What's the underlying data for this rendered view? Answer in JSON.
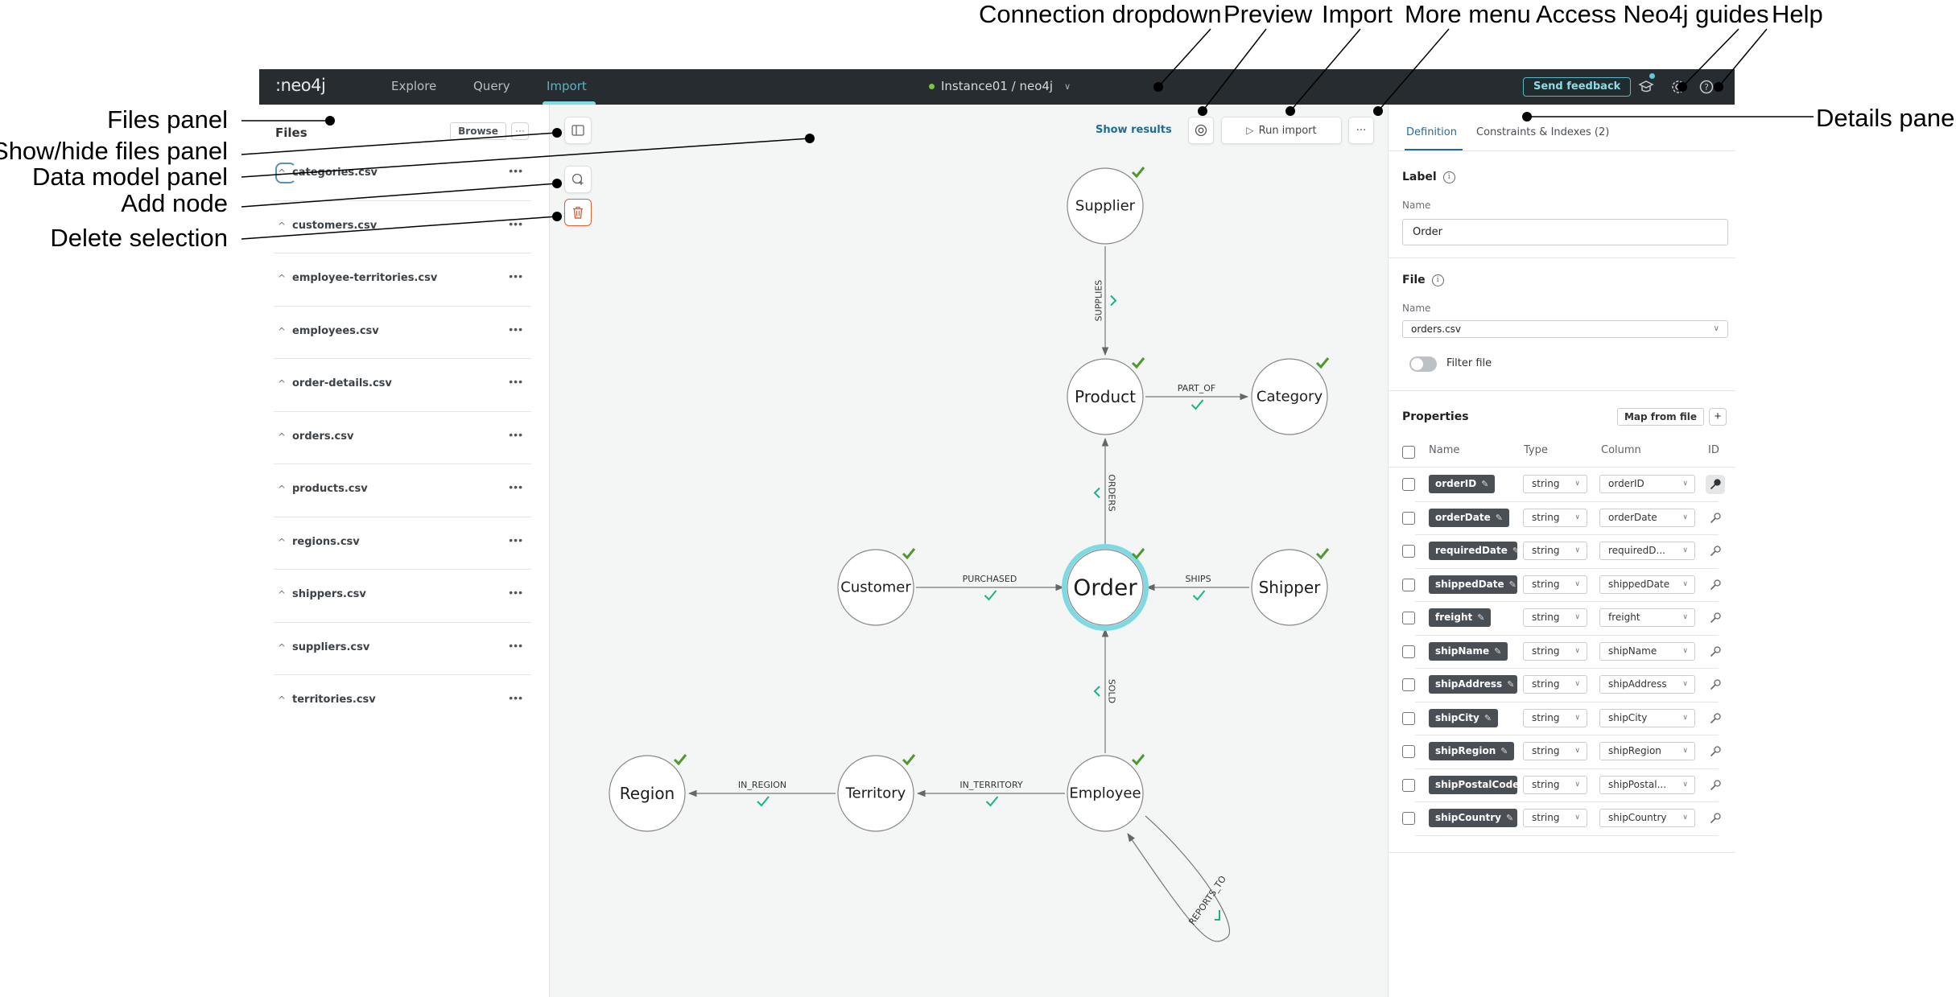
{
  "annotations": {
    "top": [
      "Connection dropdown",
      "Preview",
      "Import",
      "More menu",
      "Access Neo4j guides",
      "Help"
    ],
    "left": [
      "Files panel",
      "Show/hide files panel",
      "Data model panel",
      "Add node",
      "Delete selection"
    ],
    "right": [
      "Details panel"
    ]
  },
  "nav": {
    "logo": ":neo4j",
    "tabs": [
      {
        "label": "Explore",
        "active": false
      },
      {
        "label": "Query",
        "active": false
      },
      {
        "label": "Import",
        "active": true
      }
    ],
    "connection": "Instance01 / neo4j",
    "connection_status_color": "#7cc242",
    "feedback_label": "Send feedback",
    "icons": [
      "graduation-cap-icon",
      "gear-icon",
      "help-icon"
    ]
  },
  "files": {
    "title": "Files",
    "browse_label": "Browse",
    "more_label": "···",
    "items": [
      {
        "name": "categories.csv"
      },
      {
        "name": "customers.csv"
      },
      {
        "name": "employee-territories.csv"
      },
      {
        "name": "employees.csv"
      },
      {
        "name": "order-details.csv"
      },
      {
        "name": "orders.csv"
      },
      {
        "name": "products.csv"
      },
      {
        "name": "regions.csv"
      },
      {
        "name": "shippers.csv"
      },
      {
        "name": "suppliers.csv"
      },
      {
        "name": "territories.csv"
      }
    ]
  },
  "canvas": {
    "show_results_label": "Show results",
    "run_import_label": "Run import",
    "more_label": "···",
    "nodes": [
      {
        "id": "supplier",
        "label": "Supplier",
        "mapped": true,
        "selected": false
      },
      {
        "id": "product",
        "label": "Product",
        "mapped": true,
        "selected": false
      },
      {
        "id": "category",
        "label": "Category",
        "mapped": true,
        "selected": false
      },
      {
        "id": "customer",
        "label": "Customer",
        "mapped": true,
        "selected": false
      },
      {
        "id": "order",
        "label": "Order",
        "mapped": true,
        "selected": true
      },
      {
        "id": "shipper",
        "label": "Shipper",
        "mapped": true,
        "selected": false
      },
      {
        "id": "region",
        "label": "Region",
        "mapped": true,
        "selected": false
      },
      {
        "id": "territory",
        "label": "Territory",
        "mapped": true,
        "selected": false
      },
      {
        "id": "employee",
        "label": "Employee",
        "mapped": true,
        "selected": false
      }
    ],
    "relationships": [
      {
        "type": "SUPPLIES",
        "from": "supplier",
        "to": "product",
        "mapped": true
      },
      {
        "type": "PART_OF",
        "from": "product",
        "to": "category",
        "mapped": true
      },
      {
        "type": "ORDERS",
        "from": "order",
        "to": "product",
        "mapped": true
      },
      {
        "type": "PURCHASED",
        "from": "customer",
        "to": "order",
        "mapped": true
      },
      {
        "type": "SHIPS",
        "from": "shipper",
        "to": "order",
        "mapped": true
      },
      {
        "type": "SOLD",
        "from": "employee",
        "to": "order",
        "mapped": true
      },
      {
        "type": "IN_REGION",
        "from": "territory",
        "to": "region",
        "mapped": true
      },
      {
        "type": "IN_TERRITORY",
        "from": "employee",
        "to": "territory",
        "mapped": true
      },
      {
        "type": "REPORTS_TO",
        "from": "employee",
        "to": "employee",
        "mapped": true
      }
    ],
    "colors": {
      "selected_ring": "#7fd9e3",
      "node_check": "#4c9a2a",
      "rel_check": "#19b38a"
    }
  },
  "details": {
    "tabs": [
      {
        "label": "Definition",
        "active": true
      },
      {
        "label": "Constraints & Indexes (2)",
        "active": false
      }
    ],
    "label_section": {
      "title": "Label",
      "name_label": "Name",
      "name_value": "Order"
    },
    "file_section": {
      "title": "File",
      "name_label": "Name",
      "file_value": "orders.csv",
      "filter_label": "Filter file",
      "filter_on": false
    },
    "properties": {
      "title": "Properties",
      "map_label": "Map from file",
      "add_label": "+",
      "headers": {
        "name": "Name",
        "type": "Type",
        "column": "Column",
        "id": "ID"
      },
      "rows": [
        {
          "name": "orderID",
          "type": "string",
          "column": "orderID",
          "is_id": true
        },
        {
          "name": "orderDate",
          "type": "string",
          "column": "orderDate",
          "is_id": false
        },
        {
          "name": "requiredDate",
          "type": "string",
          "column": "requiredD...",
          "is_id": false
        },
        {
          "name": "shippedDate",
          "type": "string",
          "column": "shippedDate",
          "is_id": false
        },
        {
          "name": "freight",
          "type": "string",
          "column": "freight",
          "is_id": false
        },
        {
          "name": "shipName",
          "type": "string",
          "column": "shipName",
          "is_id": false
        },
        {
          "name": "shipAddress",
          "type": "string",
          "column": "shipAddress",
          "is_id": false
        },
        {
          "name": "shipCity",
          "type": "string",
          "column": "shipCity",
          "is_id": false
        },
        {
          "name": "shipRegion",
          "type": "string",
          "column": "shipRegion",
          "is_id": false
        },
        {
          "name": "shipPostalCode",
          "type": "string",
          "column": "shipPostal...",
          "is_id": false
        },
        {
          "name": "shipCountry",
          "type": "string",
          "column": "shipCountry",
          "is_id": false
        }
      ]
    }
  }
}
